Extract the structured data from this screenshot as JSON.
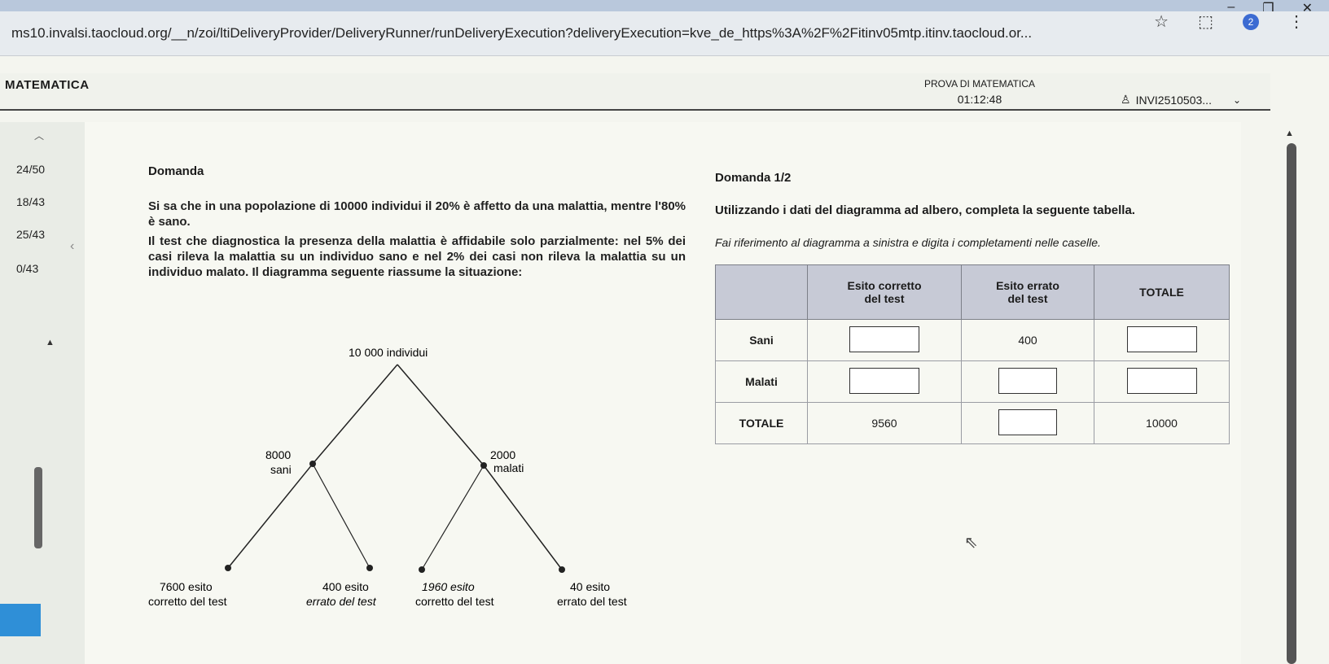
{
  "browser": {
    "url": "ms10.invalsi.taocloud.org/__n/zoi/ltiDeliveryProvider/DeliveryRunner/runDeliveryExecution?deliveryExecution=kve_de_https%3A%2F%2Fitinv05mtp.itinv.taocloud.or...",
    "profile_badge": "2"
  },
  "header": {
    "app_title": "MATEMATICA",
    "test_name": "PROVA DI MATEMATICA",
    "timer": "01:12:48",
    "user_id": "INVI2510503..."
  },
  "sidebar": {
    "items": [
      "24/50",
      "18/43",
      "25/43",
      "0/43"
    ]
  },
  "question": {
    "label": "Domanda",
    "text_1": "Si sa che in una popolazione di 10000 individui il 20% è affetto da una malattia, mentre l'80% è sano.",
    "text_2": "Il test che diagnostica la presenza della malattia è affidabile solo parzialmente: nel 5% dei casi rileva la malattia su un individuo sano e nel 2% dei casi non rileva la malattia su un individuo malato. Il diagramma seguente riassume la situazione:",
    "tree": {
      "root": "10 000 individui",
      "left_value": "8000",
      "left_label": "sani",
      "right_value": "2000",
      "right_label": "malati",
      "leaf1_line1": "7600  esito",
      "leaf1_line2": "corretto del test",
      "leaf2_line1": "400 esito",
      "leaf2_line2": "errato del test",
      "leaf3_line1": "1960 esito",
      "leaf3_line2": "corretto del test",
      "leaf4_line1": "40  esito",
      "leaf4_line2": "errato del test"
    }
  },
  "subquestion": {
    "label": "Domanda 1/2",
    "instruction": "Utilizzando i dati del diagramma ad albero, completa la seguente tabella.",
    "hint": "Fai riferimento al diagramma a sinistra e digita i completamenti nelle caselle.",
    "table": {
      "col1_line1": "Esito corretto",
      "col1_line2": "del test",
      "col2_line1": "Esito errato",
      "col2_line2": "del test",
      "col3": "TOTALE",
      "row1": "Sani",
      "row2": "Malati",
      "row3": "TOTALE",
      "sani_errato": "400",
      "totale_corretto": "9560",
      "totale_totale": "10000"
    }
  }
}
